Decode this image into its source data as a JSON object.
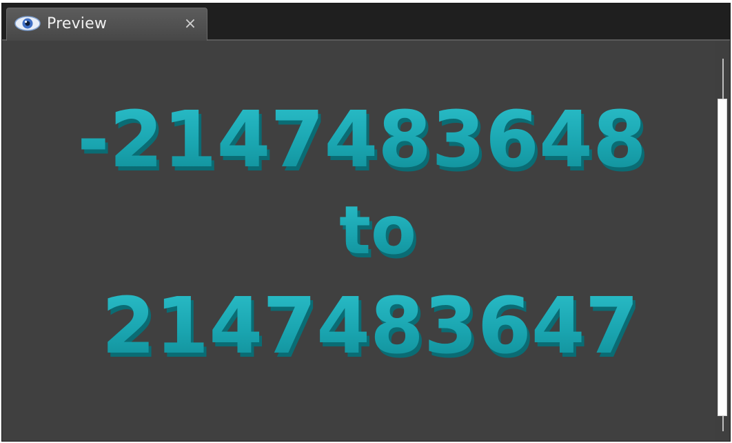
{
  "tab": {
    "title": "Preview",
    "icon": "eye-icon",
    "close_label": "×"
  },
  "preview": {
    "line1": "-2147483648",
    "line2": "to",
    "line3": "2147483647",
    "text_color": "#1aa5b0",
    "background_color": "#404040"
  },
  "scrollbar": {
    "orientation": "vertical"
  }
}
